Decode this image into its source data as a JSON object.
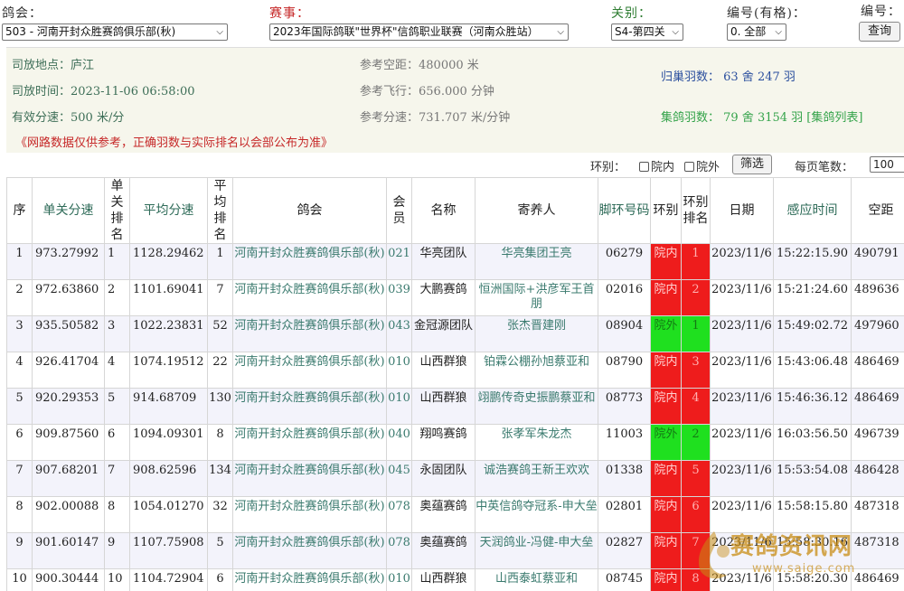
{
  "filters": {
    "club_label": "鸽会：",
    "club_value": "503 - 河南开封众胜赛鸽俱乐部(秋)",
    "race_label": "赛事：",
    "race_value": "2023年国际鸽联\"世界杯\"信鸽职业联赛（河南众胜站）",
    "stage_label": "关别：",
    "stage_value": "S4-第四关",
    "num_mode_label": "编号(有格)：",
    "num_mode_value": "0. 全部",
    "num_label": "编号：",
    "query_button": "查询"
  },
  "info": {
    "release_place_label": "司放地点：",
    "release_place": "庐江",
    "release_time_label": "司放时间：",
    "release_time": "2023-11-06 06:58:00",
    "valid_speed_label": "有效分速：",
    "valid_speed": "500 米/分",
    "ref_distance_label": "参考空距：",
    "ref_distance": "480000 米",
    "ref_flight_label": "参考飞行：",
    "ref_flight": "656.000 分钟",
    "ref_speed_label": "参考分速：",
    "ref_speed": "731.707 米/分钟",
    "returned": "归巢羽数：  63 舍  247 羽",
    "collected": "集鸽羽数：  79 舍  3154 羽",
    "collected_link": "[集鸽列表]",
    "notice": "《网路数据仅供参考，正确羽数与实际排名以会部公布为准》"
  },
  "filter_row": {
    "ring_label": "环别：",
    "inside_label": "院内",
    "outside_label": "院外",
    "filter_button": "筛选",
    "page_size_label": "每页笔数：",
    "page_size_value": "100"
  },
  "table": {
    "headers": [
      "序",
      "单关分速",
      "单关排名",
      "平均分速",
      "平均排名",
      "鸽会",
      "会员",
      "名称",
      "寄养人",
      "脚环号码",
      "环别",
      "环别排名",
      "日期",
      "感应时间",
      "空距"
    ],
    "rows": [
      {
        "seq": "1",
        "speed": "973.27992",
        "rank": "1",
        "avg": "1128.29462",
        "avg_rank": "1",
        "club": "河南开封众胜赛鸽俱乐部(秋)",
        "member": "021",
        "name": "华亮团队",
        "owner": "华亮集团王亮",
        "ring": "06279",
        "ring_type": "院内",
        "ring_rank": "1",
        "date": "2023/11/6",
        "time": "15:22:15.90",
        "dist": "490791"
      },
      {
        "seq": "2",
        "speed": "972.63860",
        "rank": "2",
        "avg": "1101.69041",
        "avg_rank": "7",
        "club": "河南开封众胜赛鸽俱乐部(秋)",
        "member": "039",
        "name": "大鹏赛鸽",
        "owner": "恒洲国际+洪彦军王首朋",
        "ring": "02016",
        "ring_type": "院内",
        "ring_rank": "2",
        "date": "2023/11/6",
        "time": "15:21:24.60",
        "dist": "489636"
      },
      {
        "seq": "3",
        "speed": "935.50582",
        "rank": "3",
        "avg": "1022.23831",
        "avg_rank": "52",
        "club": "河南开封众胜赛鸽俱乐部(秋)",
        "member": "043",
        "name": "金冠源团队",
        "owner": "张杰晋建刚",
        "ring": "08904",
        "ring_type": "院外",
        "ring_rank": "1",
        "date": "2023/11/6",
        "time": "15:49:02.72",
        "dist": "497960"
      },
      {
        "seq": "4",
        "speed": "926.41704",
        "rank": "4",
        "avg": "1074.19512",
        "avg_rank": "22",
        "club": "河南开封众胜赛鸽俱乐部(秋)",
        "member": "010",
        "name": "山西群狼",
        "owner": "铂霖公棚孙旭蔡亚和",
        "ring": "08790",
        "ring_type": "院内",
        "ring_rank": "3",
        "date": "2023/11/6",
        "time": "15:43:06.48",
        "dist": "486469"
      },
      {
        "seq": "5",
        "speed": "920.29353",
        "rank": "5",
        "avg": "914.68709",
        "avg_rank": "130",
        "club": "河南开封众胜赛鸽俱乐部(秋)",
        "member": "010",
        "name": "山西群狼",
        "owner": "翊鹏传奇史振鹏蔡亚和",
        "ring": "08773",
        "ring_type": "院内",
        "ring_rank": "4",
        "date": "2023/11/6",
        "time": "15:46:36.12",
        "dist": "486469"
      },
      {
        "seq": "6",
        "speed": "909.87560",
        "rank": "6",
        "avg": "1094.09301",
        "avg_rank": "8",
        "club": "河南开封众胜赛鸽俱乐部(秋)",
        "member": "040",
        "name": "翔鸣赛鸽",
        "owner": "张孝军朱龙杰",
        "ring": "11003",
        "ring_type": "院外",
        "ring_rank": "2",
        "date": "2023/11/6",
        "time": "16:03:56.50",
        "dist": "496739"
      },
      {
        "seq": "7",
        "speed": "907.68201",
        "rank": "7",
        "avg": "908.62596",
        "avg_rank": "134",
        "club": "河南开封众胜赛鸽俱乐部(秋)",
        "member": "045",
        "name": "永固团队",
        "owner": "诚浩赛鸽王新王欢欢",
        "ring": "01338",
        "ring_type": "院内",
        "ring_rank": "5",
        "date": "2023/11/6",
        "time": "15:53:54.08",
        "dist": "486428"
      },
      {
        "seq": "8",
        "speed": "902.00088",
        "rank": "8",
        "avg": "1054.01270",
        "avg_rank": "32",
        "club": "河南开封众胜赛鸽俱乐部(秋)",
        "member": "078",
        "name": "奥蕴赛鸽",
        "owner": "中英信鸽夺冠系-申大垒",
        "ring": "02801",
        "ring_type": "院内",
        "ring_rank": "6",
        "date": "2023/11/6",
        "time": "15:58:15.80",
        "dist": "487318"
      },
      {
        "seq": "9",
        "speed": "901.60147",
        "rank": "9",
        "avg": "1107.75908",
        "avg_rank": "5",
        "club": "河南开封众胜赛鸽俱乐部(秋)",
        "member": "078",
        "name": "奥蕴赛鸽",
        "owner": "天润鸽业-冯健-申大垒",
        "ring": "02827",
        "ring_type": "院内",
        "ring_rank": "7",
        "date": "2023/11/6",
        "time": "15:58:30.16",
        "dist": "487318"
      },
      {
        "seq": "10",
        "speed": "900.30444",
        "rank": "10",
        "avg": "1104.72904",
        "avg_rank": "6",
        "club": "河南开封众胜赛鸽俱乐部(秋)",
        "member": "010",
        "name": "山西群狼",
        "owner": "山西泰虹蔡亚和",
        "ring": "08745",
        "ring_type": "院内",
        "ring_rank": "8",
        "date": "2023/11/6",
        "time": "15:58:20.30",
        "dist": "486469"
      }
    ]
  },
  "watermark": {
    "name": "赛鸽资讯网",
    "url": "www.saige.com"
  },
  "colors": {
    "inside_red": "#ee1c1c",
    "outside_green": "#1fe01f",
    "link_teal": "#3a7a6e",
    "notice_red": "#c62828"
  }
}
